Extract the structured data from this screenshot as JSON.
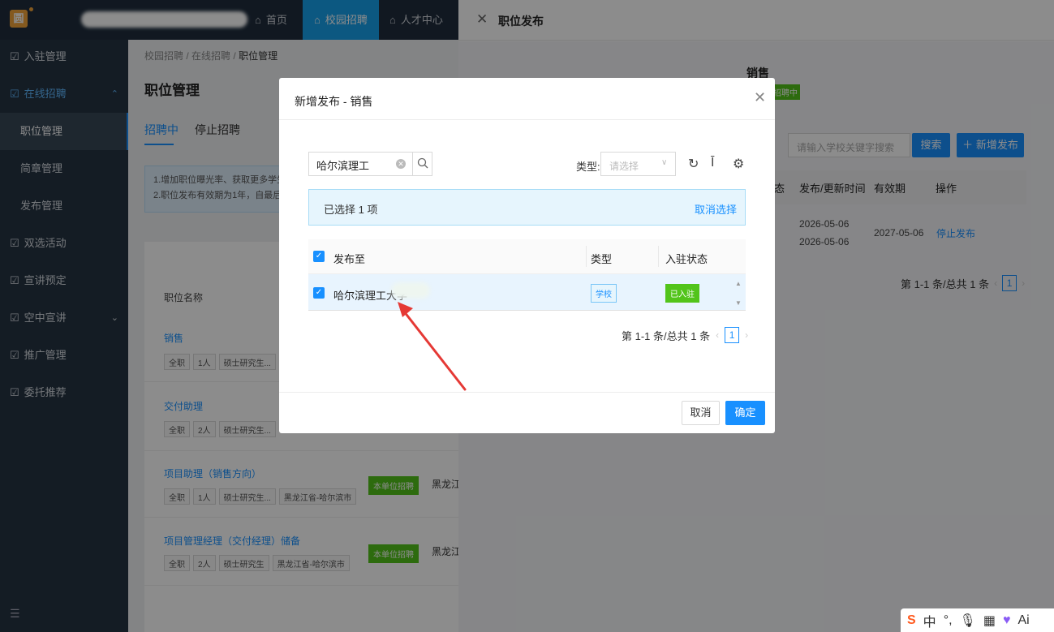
{
  "topnav": {
    "logo_text": "圆",
    "items": [
      {
        "label": "首页",
        "icon": "home-icon"
      },
      {
        "label": "校园招聘",
        "icon": "home-icon"
      },
      {
        "label": "人才中心",
        "icon": "home-icon"
      }
    ]
  },
  "sidebar": {
    "items": [
      {
        "label": "入驻管理"
      },
      {
        "label": "在线招聘"
      },
      {
        "label": "职位管理"
      },
      {
        "label": "简章管理"
      },
      {
        "label": "发布管理"
      },
      {
        "label": "双选活动"
      },
      {
        "label": "宣讲预定"
      },
      {
        "label": "空中宣讲"
      },
      {
        "label": "推广管理"
      },
      {
        "label": "委托推荐"
      }
    ]
  },
  "page": {
    "breadcrumb": {
      "a": "校园招聘",
      "b": "在线招聘",
      "c": "职位管理",
      "sep": "/"
    },
    "title": "职位管理",
    "tabs": [
      {
        "label": "招聘中"
      },
      {
        "label": "停止招聘"
      }
    ],
    "notice": {
      "line1": "1.增加职位曝光率、获取更多学生",
      "line2": "2.职位发布有效期为1年，自最后"
    },
    "col_job_name": "职位名称",
    "jobs": [
      {
        "name": "销售",
        "tags": [
          "全职",
          "1人",
          "硕士研究生..."
        ]
      },
      {
        "name": "交付助理",
        "tags": [
          "全职",
          "2人",
          "硕士研究生..."
        ]
      },
      {
        "name": "项目助理（销售方向）",
        "tags": [
          "全职",
          "1人",
          "硕士研究生...",
          "黑龙江省-哈尔滨市"
        ],
        "badge": "本单位招聘",
        "region": "黑龙江"
      },
      {
        "name": "项目管理经理（交付经理）储备",
        "tags": [
          "全职",
          "2人",
          "硕士研究生",
          "黑龙江省-哈尔滨市"
        ],
        "badge": "本单位招聘",
        "region": "黑龙江"
      }
    ]
  },
  "drawer": {
    "title": "职位发布",
    "job_name": "销售",
    "status_badge": "招聘中",
    "search_placeholder": "请输入学校关键字搜索",
    "search_button": "搜索",
    "add_button": "新增发布",
    "columns": {
      "c0": "态",
      "c1": "发布/更新时间",
      "c2": "有效期",
      "c3": "操作"
    },
    "row": {
      "publish_time": "2026-05-06",
      "update_time": "2026-05-06",
      "valid_until": "2027-05-06",
      "action": "停止发布"
    },
    "pagination": {
      "summary": "第 1-1 条/总共 1 条",
      "page": "1"
    }
  },
  "modal": {
    "title": "新增发布 - 销售",
    "search_value": "哈尔滨理工",
    "type_label": "类型:",
    "type_placeholder": "请选择",
    "selected_info": "已选择 1 项",
    "cancel_selection": "取消选择",
    "columns": {
      "publish_to": "发布至",
      "type": "类型",
      "status": "入驻状态"
    },
    "row": {
      "school": "哈尔滨理工大学",
      "type": "学校",
      "status": "已入驻"
    },
    "pagination": {
      "summary": "第 1-1 条/总共 1 条",
      "page": "1"
    },
    "cancel_button": "取消",
    "ok_button": "确定"
  },
  "ime": {
    "zh": "中",
    "ai": "Ai"
  },
  "colors": {
    "primary": "#1890ff",
    "success": "#52c41a",
    "sidebar": "#253342",
    "annotation_arrow": "#e53935"
  }
}
